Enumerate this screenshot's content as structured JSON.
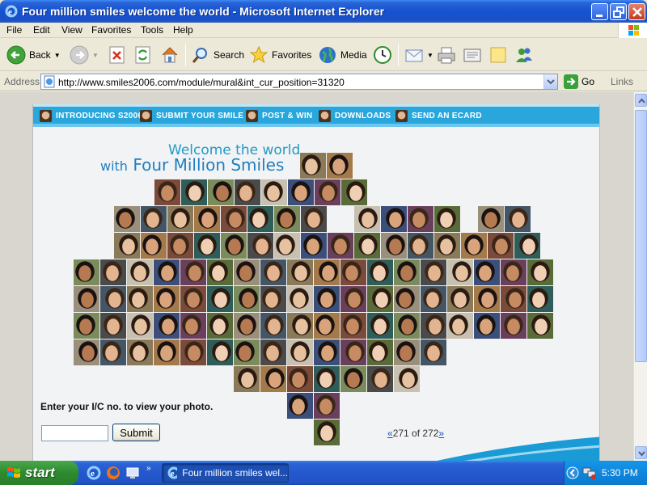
{
  "window": {
    "title": "Four million smiles welcome the world - Microsoft Internet Explorer"
  },
  "menu": [
    "File",
    "Edit",
    "View",
    "Favorites",
    "Tools",
    "Help"
  ],
  "toolbar": {
    "back_label": "Back",
    "search_label": "Search",
    "favorites_label": "Favorites",
    "media_label": "Media"
  },
  "address": {
    "label": "Address",
    "url": "http://www.smiles2006.com/module/mural&int_cur_position=31320",
    "go_label": "Go",
    "links_label": "Links"
  },
  "site": {
    "nav": [
      "INTRODUCING S2006",
      "SUBMIT YOUR SMILE",
      "POST & WIN",
      "DOWNLOADS",
      "SEND AN ECARD"
    ],
    "welcome_line1": "Welcome the world",
    "welcome_with": "with",
    "welcome_line2": "Four Million Smiles",
    "prompt": "Enter your I/C no. to view your photo.",
    "ic_value": "",
    "submit_label": "Submit",
    "pager_prev": "«",
    "pager_text": "271 of 272",
    "pager_next": "»"
  },
  "taskbar": {
    "start_label": "start",
    "task_label": "Four million smiles wel...",
    "clock": "5:30 PM"
  },
  "colors": {
    "nav_bar": "#29a7dc",
    "welcome_text": "#1f9bc9",
    "xp_blue": "#2458cc",
    "start_green": "#2d8a2f"
  }
}
